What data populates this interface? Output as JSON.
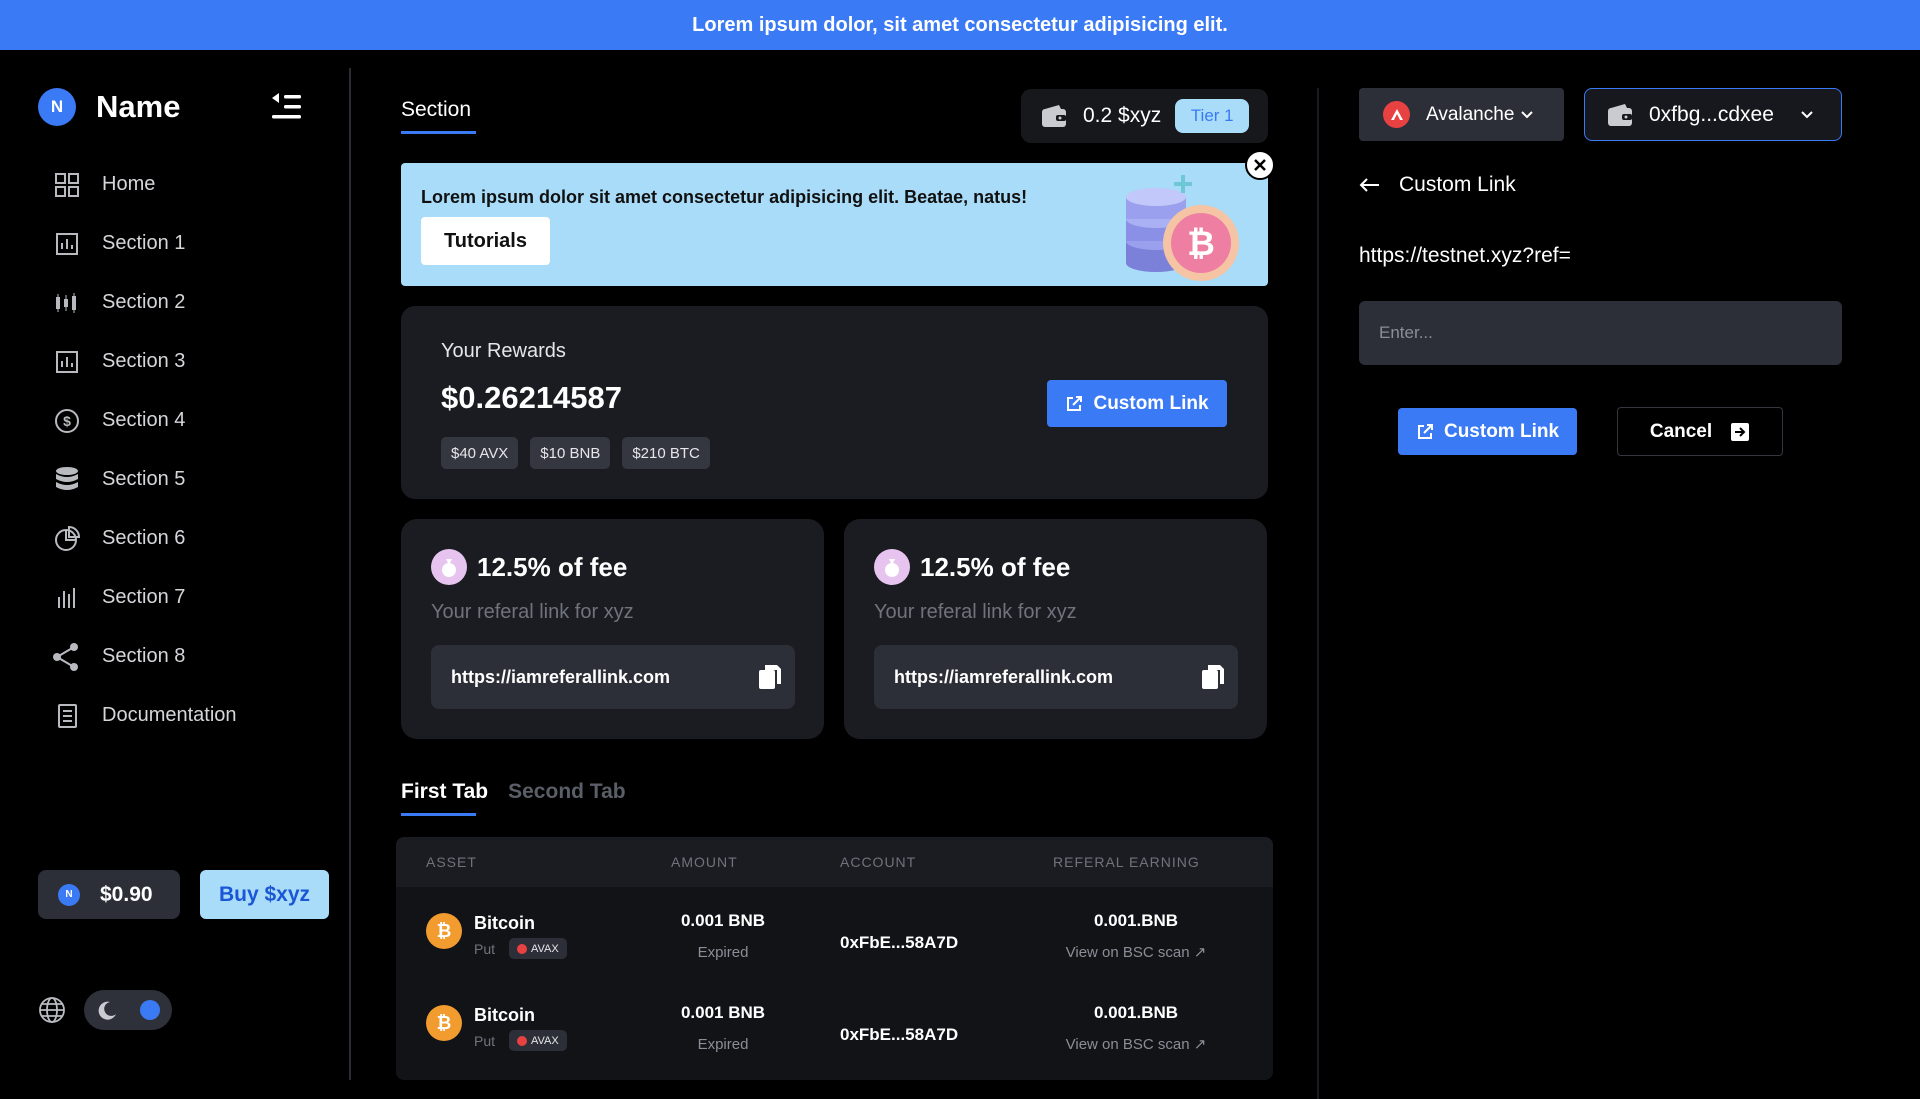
{
  "announcement": "Lorem ipsum dolor, sit amet consectetur adipisicing elit.",
  "brand": {
    "logo_letter": "N",
    "name": "Name"
  },
  "sidebar": {
    "items": [
      {
        "label": "Home",
        "icon": "grid-icon"
      },
      {
        "label": "Section 1",
        "icon": "bar-chart-icon"
      },
      {
        "label": "Section 2",
        "icon": "candlestick-icon"
      },
      {
        "label": "Section 3",
        "icon": "bar-chart-icon"
      },
      {
        "label": "Section 4",
        "icon": "dollar-circle-icon"
      },
      {
        "label": "Section 5",
        "icon": "database-icon"
      },
      {
        "label": "Section 6",
        "icon": "pie-chart-icon"
      },
      {
        "label": "Section 7",
        "icon": "signal-bars-icon"
      },
      {
        "label": "Section 8",
        "icon": "share-icon"
      },
      {
        "label": "Documentation",
        "icon": "document-icon"
      }
    ],
    "price_logo_letter": "N",
    "price": "$0.90",
    "buy_label": "Buy $xyz"
  },
  "main": {
    "section_tab": "Section",
    "balance": "0.2 $xyz",
    "tier": "Tier 1",
    "banner": {
      "text": "Lorem ipsum dolor sit amet consectetur adipisicing elit. Beatae, natus!",
      "button": "Tutorials"
    },
    "rewards": {
      "title": "Your Rewards",
      "amount": "$0.26214587",
      "chips": [
        "$40 AVX",
        "$10 BNB",
        "$210 BTC"
      ],
      "button": "Custom Link"
    },
    "fee_cards": [
      {
        "title": "12.5% of fee",
        "subtitle": "Your referal link for xyz",
        "link": "https://iamreferallink.com"
      },
      {
        "title": "12.5% of fee",
        "subtitle": "Your referal link for xyz",
        "link": "https://iamreferallink.com"
      }
    ],
    "tabs": [
      "First Tab",
      "Second Tab"
    ],
    "table": {
      "headers": [
        "ASSET",
        "AMOUNT",
        "ACCOUNT",
        "REFERAL EARNING"
      ],
      "rows": [
        {
          "asset": "Bitcoin",
          "type": "Put",
          "network": "AVAX",
          "amount": "0.001 BNB",
          "status": "Expired",
          "account": "0xFbE...58A7D",
          "earning": "0.001.BNB",
          "scan": "View on BSC scan"
        },
        {
          "asset": "Bitcoin",
          "type": "Put",
          "network": "AVAX",
          "amount": "0.001 BNB",
          "status": "Expired",
          "account": "0xFbE...58A7D",
          "earning": "0.001.BNB",
          "scan": "View on BSC scan"
        }
      ]
    }
  },
  "right_panel": {
    "network": "Avalanche",
    "address": "0xfbg...cdxee",
    "title": "Custom Link",
    "ref_prefix": "https://testnet.xyz?ref=",
    "input_placeholder": "Enter...",
    "custom_button": "Custom Link",
    "cancel_button": "Cancel"
  },
  "colors": {
    "accent": "#3b7af5",
    "light_blue": "#a9dcf8",
    "card": "#1b1c21",
    "avax": "#e84142",
    "btc": "#f29b2e"
  }
}
